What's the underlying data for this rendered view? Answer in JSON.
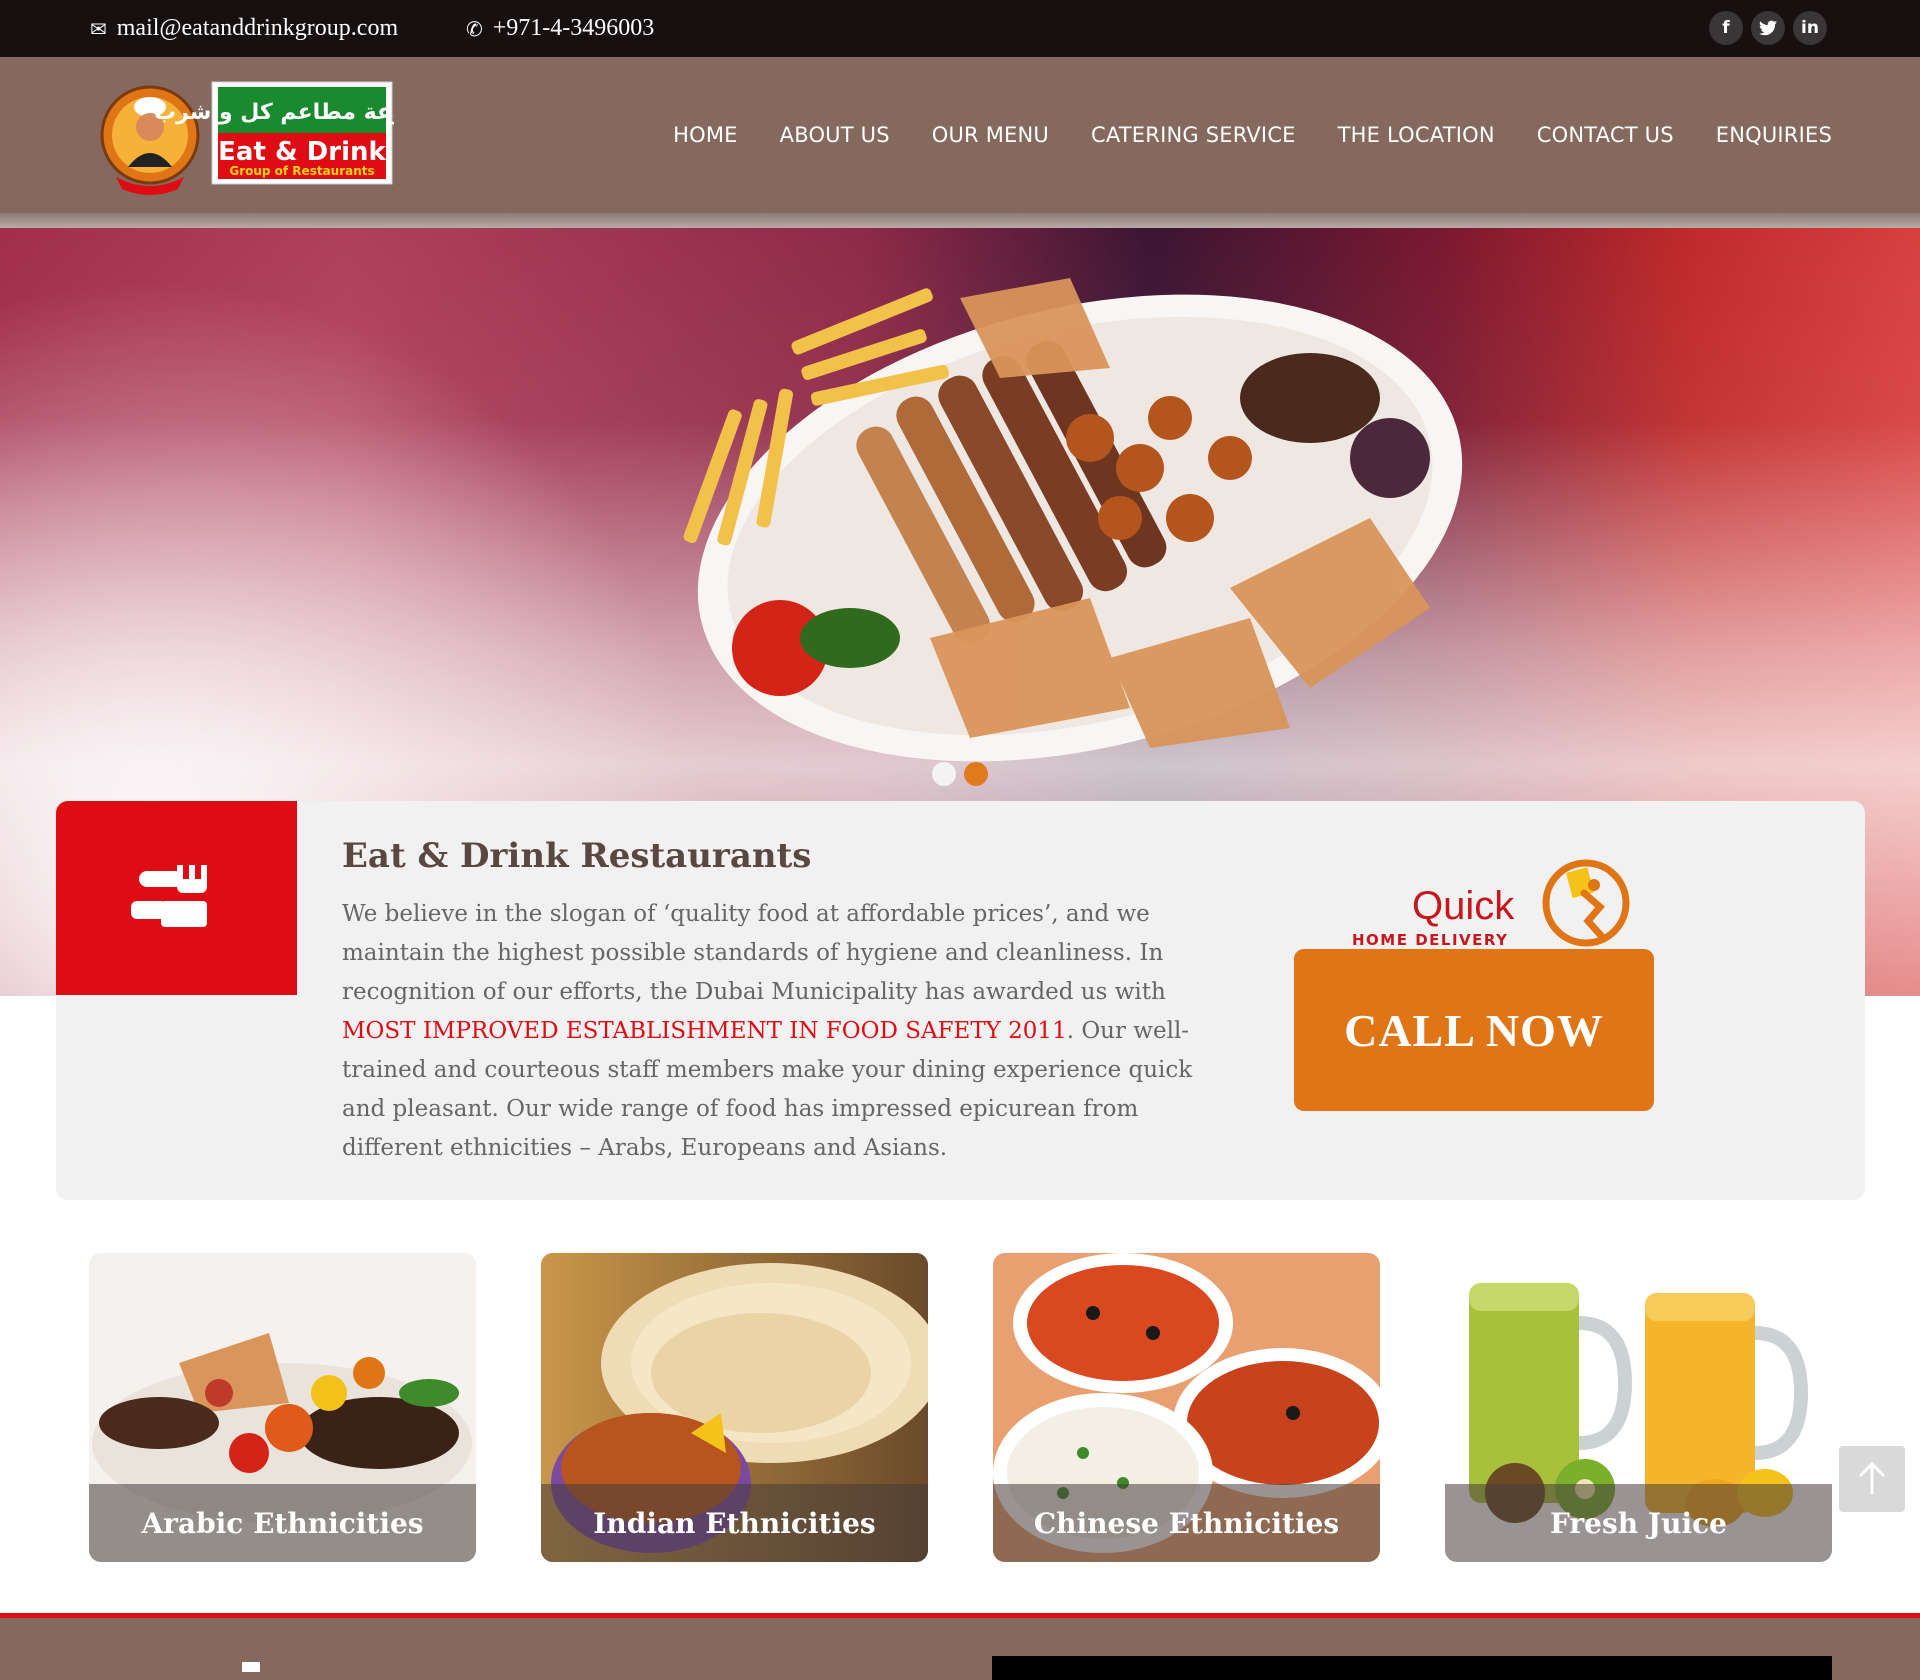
{
  "topbar": {
    "email": "mail@eatanddrinkgroup.com",
    "phone": "+971-4-3496003",
    "email_icon": "envelope-icon",
    "phone_icon": "phone-icon",
    "social": [
      {
        "name": "facebook-icon",
        "glyph": "f"
      },
      {
        "name": "twitter-icon",
        "glyph": "t"
      },
      {
        "name": "linkedin-icon",
        "glyph": "in"
      }
    ]
  },
  "header": {
    "logo_arabic": "مجموعة مطاعم كل واشرب",
    "logo_text": "Eat & Drink",
    "logo_sub": "Group of Restaurants",
    "nav": [
      "HOME",
      "ABOUT US",
      "OUR MENU",
      "CATERING SERVICE",
      "THE LOCATION",
      "CONTACT US",
      "ENQUIRIES"
    ]
  },
  "slider": {
    "active_slide": 2,
    "slide_count": 2
  },
  "info": {
    "title": "Eat & Drink Restaurants",
    "text_before": "We believe in the slogan of ‘quality food at affordable prices’, and we maintain the highest possible standards of hygiene and cleanliness. In recognition of our efforts, the Dubai Municipality has awarded us with ",
    "highlight": "MOST IMPROVED ESTABLISHMENT IN FOOD SAFETY 2011",
    "text_after": ". Our well-trained and courteous staff members make your dining experience quick and pleasant. Our wide range of food has impressed epicurean from different ethnicities – Arabs, Europeans and Asians.",
    "quick_label": "Quick",
    "delivery_label": "HOME DELIVERY",
    "call_label": "CALL NOW"
  },
  "categories": [
    {
      "label": "Arabic Ethnicities"
    },
    {
      "label": "Indian Ethnicities"
    },
    {
      "label": "Chinese Ethnicities"
    },
    {
      "label": "Fresh Juice"
    }
  ],
  "colors": {
    "brand_brown": "#85695f",
    "brand_red": "#e00c14",
    "accent_orange": "#e07516",
    "topbar": "#161011"
  }
}
